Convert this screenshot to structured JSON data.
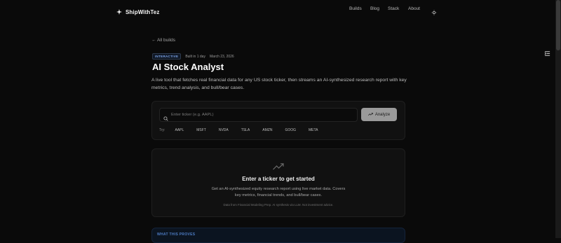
{
  "header": {
    "brand_name": "ShipWithTez",
    "nav": [
      "Builds",
      "Blog",
      "Stack",
      "About"
    ]
  },
  "page": {
    "back_link": "← All builds",
    "badge": "INTERACTIVE",
    "built_in": "Built in 1 day",
    "date": "March 23, 2026",
    "title": "AI Stock Analyst",
    "description": "A live tool that fetches real financial data for any US stock ticker, then streams an AI-synthesized research report with key metrics, trend analysis, and bull/bear cases."
  },
  "search": {
    "placeholder": "Enter ticker (e.g. AAPL)",
    "value": "",
    "analyze_label": "Analyze",
    "try_label": "Try:",
    "tickers": [
      "AAPL",
      "MSFT",
      "NVDA",
      "TSLA",
      "AMZN",
      "GOOG",
      "META"
    ]
  },
  "empty_state": {
    "title": "Enter a ticker to get started",
    "description": "Get an AI-synthesized equity research report using live market data. Covers key metrics, financial trends, and bull/bear cases.",
    "note": "Data from Financial Modeling Prep. AI synthesis via LLM. Not investment advice."
  },
  "section": {
    "what_this_proves": "WHAT THIS PROVES"
  },
  "icons": {
    "brand": "sparkle-icon",
    "theme": "sun-icon",
    "side": "sidebar-toggle-icon",
    "search": "search-icon",
    "analyze": "trending-up-icon",
    "empty": "trending-up-icon"
  },
  "colors": {
    "background": "#0a0a0a",
    "card": "#111111",
    "badge_text": "#7ea6ea",
    "analyze_button": "#9a9a9a",
    "proves_label": "#4d7cc4"
  }
}
